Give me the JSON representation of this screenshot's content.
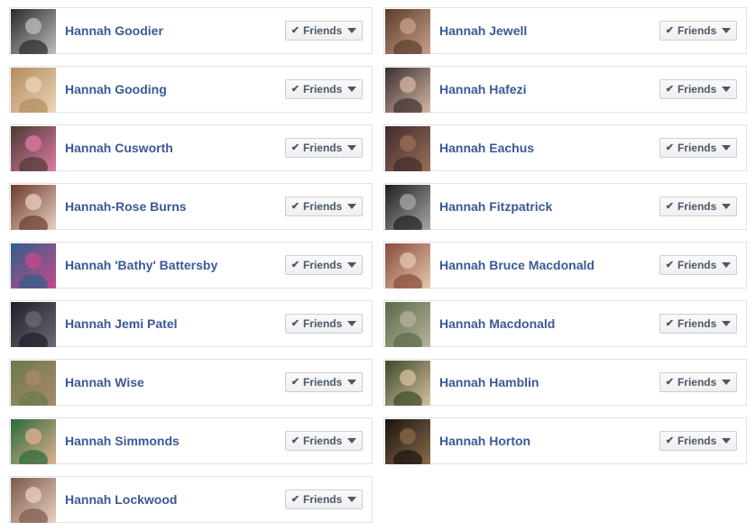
{
  "friend_button_label": "Friends",
  "icons": {
    "check": "check-icon",
    "dropdown": "caret-down-icon"
  },
  "colors": {
    "name_link": "#3b5998",
    "card_border": "#e1e2e5",
    "button_text": "#4e5665"
  },
  "friends": [
    {
      "name": "Hannah Goodier",
      "photo": [
        "#2a2a2a",
        "#bdbdbd"
      ]
    },
    {
      "name": "Hannah Jewell",
      "photo": [
        "#5a3d2a",
        "#c9a08a"
      ]
    },
    {
      "name": "Hannah Gooding",
      "photo": [
        "#b48a5e",
        "#e9d6b6"
      ]
    },
    {
      "name": "Hannah Hafezi",
      "photo": [
        "#3a2f2f",
        "#d4b7a4"
      ]
    },
    {
      "name": "Hannah Cusworth",
      "photo": [
        "#4a3a30",
        "#e07aa6"
      ]
    },
    {
      "name": "Hannah Eachus",
      "photo": [
        "#3d2b2b",
        "#9c6e58"
      ]
    },
    {
      "name": "Hannah-Rose Burns",
      "photo": [
        "#6b3b2b",
        "#e9cfc2"
      ]
    },
    {
      "name": "Hannah Fitzpatrick",
      "photo": [
        "#1f1f1f",
        "#a7a7a7"
      ]
    },
    {
      "name": "Hannah 'Bathy' Battersby",
      "photo": [
        "#2f5f8a",
        "#c64a8a"
      ]
    },
    {
      "name": "Hannah Bruce Macdonald",
      "photo": [
        "#8a4a3a",
        "#e4c8b0"
      ]
    },
    {
      "name": "Hannah Jemi Patel",
      "photo": [
        "#1e1e28",
        "#6d6a72"
      ]
    },
    {
      "name": "Hannah Macdonald",
      "photo": [
        "#5a6a4a",
        "#b8b29a"
      ]
    },
    {
      "name": "Hannah Wise",
      "photo": [
        "#6a7a4a",
        "#a88a6a"
      ]
    },
    {
      "name": "Hannah Hamblin",
      "photo": [
        "#3a4a2a",
        "#d8c0a0"
      ]
    },
    {
      "name": "Hannah Simmonds",
      "photo": [
        "#2a6a3a",
        "#e0b090"
      ]
    },
    {
      "name": "Hannah Horton",
      "photo": [
        "#1a1410",
        "#8a6a4a"
      ]
    },
    {
      "name": "Hannah Lockwood",
      "photo": [
        "#7a5a4a",
        "#e8d0c0"
      ]
    }
  ]
}
